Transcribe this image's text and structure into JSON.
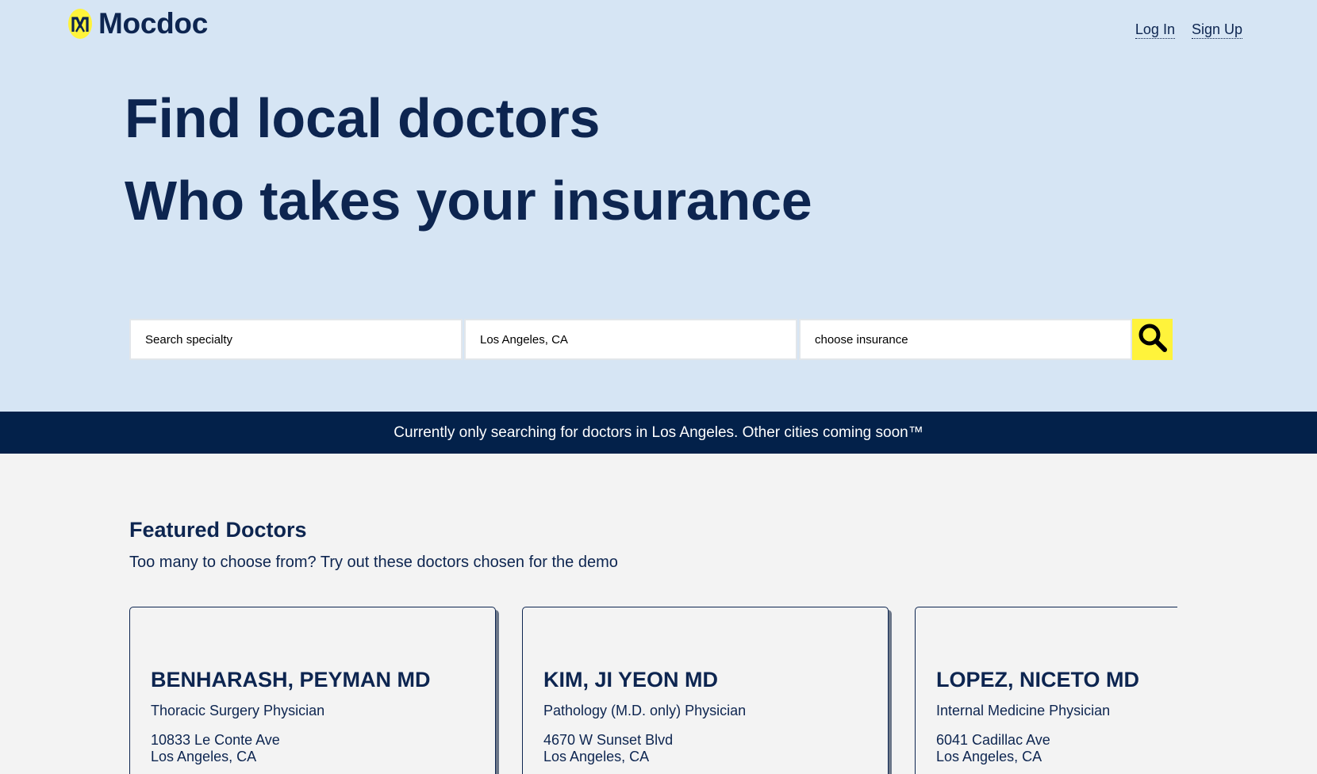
{
  "brand": {
    "name": "Mocdoc",
    "logo_icon": "m-logo-icon",
    "accent_color": "#fff33b",
    "primary_color": "#0d2550"
  },
  "nav": {
    "login": "Log In",
    "signup": "Sign Up"
  },
  "hero": {
    "line1": "Find local doctors",
    "line2": "Who takes your insurance",
    "background": "#d6e5f4"
  },
  "search": {
    "specialty_placeholder": "Search specialty",
    "location_value": "Los Angeles, CA",
    "insurance_placeholder": "choose insurance",
    "button_icon": "search-icon"
  },
  "banner": {
    "text": "Currently only searching for doctors in Los Angeles. Other cities coming soon™"
  },
  "featured": {
    "title": "Featured Doctors",
    "subtitle": "Too many to choose from? Try out these doctors chosen for the demo",
    "doctors": [
      {
        "name": "BENHARASH, PEYMAN MD",
        "specialty": "Thoracic Surgery Physician",
        "address_line1": "10833 Le Conte Ave",
        "address_line2": "Los Angeles, CA"
      },
      {
        "name": "KIM, JI YEON MD",
        "specialty": "Pathology (M.D. only) Physician",
        "address_line1": "4670 W Sunset Blvd",
        "address_line2": "Los Angeles, CA"
      },
      {
        "name": "LOPEZ, NICETO MD",
        "specialty": "Internal Medicine Physician",
        "address_line1": "6041 Cadillac Ave",
        "address_line2": "Los Angeles, CA"
      }
    ]
  }
}
